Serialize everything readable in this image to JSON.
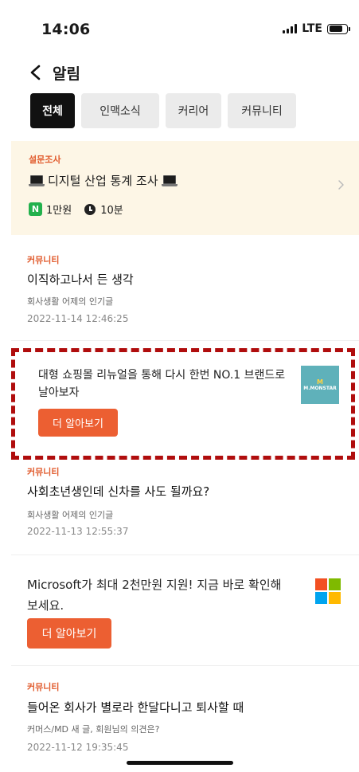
{
  "status_bar": {
    "time": "14:06",
    "network": "LTE",
    "battery_level": 0.8
  },
  "header": {
    "back_icon": "chevron-left-icon",
    "title": "알림"
  },
  "tabs": [
    {
      "label": "전체",
      "active": true
    },
    {
      "label": "인맥소식",
      "active": false
    },
    {
      "label": "커리어",
      "active": false
    },
    {
      "label": "커뮤니티",
      "active": false
    }
  ],
  "survey": {
    "category": "설문조사",
    "title": "디지털 산업 통계 조사",
    "title_icon": "laptop-icon",
    "reward_badge": "N",
    "reward": "1만원",
    "duration": "10분"
  },
  "feed": [
    {
      "category": "커뮤니티",
      "title": "이직하고나서 든 생각",
      "subtitle": "회사생활 어제의 인기글",
      "date": "2022-11-14 12:46:25"
    },
    {
      "category": "커뮤니티",
      "title": "사회초년생인데 신차를 사도 될까요?",
      "subtitle": "회사생활 어제의 인기글",
      "date": "2022-11-13 12:55:37"
    },
    {
      "category": "커뮤니티",
      "title": "들어온 회사가 별로라 한달다니고 퇴사할 때",
      "subtitle": "커머스/MD 새 글, 회원님의 의견은?",
      "date": "2022-11-12 19:35:45"
    }
  ],
  "ads": [
    {
      "text_line1": "대형 쇼핑몰 리뉴얼을 통해 다시 한번 NO.1 브랜드로",
      "text_line2": "날아보자",
      "cta": "더 알아보기",
      "logo_top": "M",
      "logo_bottom": "M.MONSTAR"
    },
    {
      "text_line1": "Microsoft가 최대 2천만원 지원! 지금 바로 확인해",
      "text_line2": "보세요.",
      "cta": "더 알아보기",
      "logo": "microsoft-logo-icon"
    }
  ],
  "colors": {
    "accent": "#e15b2d",
    "cta": "#ec5f32",
    "survey_bg": "#fdf6e6",
    "highlight": "#b00d0d",
    "tab_active": "#111111",
    "tab_inactive": "#ebebeb",
    "ms_red": "#f25022",
    "ms_green": "#7fba00",
    "ms_blue": "#00a4ef",
    "ms_yellow": "#ffb900"
  }
}
